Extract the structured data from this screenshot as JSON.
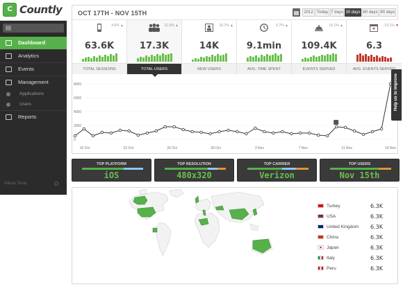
{
  "app": {
    "name": "Countly",
    "logo_mark": "C"
  },
  "sidebar": {
    "items": [
      {
        "label": "Dashboard",
        "icon": "dashboard-icon",
        "active": true
      },
      {
        "label": "Analytics",
        "icon": "analytics-icon"
      },
      {
        "label": "Events",
        "icon": "events-icon"
      },
      {
        "label": "Management",
        "icon": "management-icon"
      }
    ],
    "sub_items": [
      {
        "label": "Applications",
        "icon": "applications-icon"
      },
      {
        "label": "Users",
        "icon": "users-icon"
      }
    ],
    "reports": {
      "label": "Reports",
      "icon": "reports-icon"
    },
    "footer_user": "Nikola Tesla"
  },
  "header": {
    "date_range": "OCT 17TH - NOV 15TH",
    "periods": [
      "2012",
      "Today",
      "7 days",
      "30 days",
      "60 days",
      "90 days"
    ],
    "selected_period": "30 days"
  },
  "metrics": [
    {
      "label": "TOTAL SESSIONS",
      "value": "63.6K",
      "pct": "4.6%",
      "trend": "up",
      "icon": "phone-icon"
    },
    {
      "label": "TOTAL USERS",
      "value": "17.3K",
      "pct": "21.9%",
      "trend": "up",
      "icon": "users-group-icon"
    },
    {
      "label": "NEW USERS",
      "value": "14K",
      "pct": "10.7%",
      "trend": "up",
      "icon": "new-user-icon"
    },
    {
      "label": "AVG. TIME SPENT",
      "value": "9.1min",
      "pct": "5.7%",
      "trend": "up",
      "icon": "clock-icon"
    },
    {
      "label": "EVENTS SERVED",
      "value": "109.4K",
      "pct": "16.1%",
      "trend": "up",
      "icon": "cloche-icon"
    },
    {
      "label": "AVG. EVENTS SERVED",
      "value": "6.3",
      "pct": "-23.1%",
      "trend": "down",
      "icon": "calendar-down-icon"
    }
  ],
  "selected_metric": "TOTAL USERS",
  "chart_data": {
    "type": "line",
    "x_ticks": [
      "16 Oct",
      "22 Oct",
      "26 Oct",
      "30 Oct",
      "3 Nov",
      "7 Nov",
      "11 Nov",
      "14 Nov"
    ],
    "y_ticks": [
      "8000",
      "6000",
      "4000",
      "2000",
      "0"
    ],
    "ylim": [
      0,
      8000
    ],
    "series": [
      {
        "values": [
          500,
          1500,
          500,
          1000,
          900,
          1300,
          1200,
          600,
          900,
          1200,
          1800,
          1800,
          1400,
          1100,
          1000,
          800,
          1100,
          1300,
          1100,
          800,
          1600,
          1100,
          900,
          1100,
          800,
          900,
          900,
          600,
          500,
          1800,
          1700,
          1200,
          700,
          1100,
          1500,
          9000
        ]
      }
    ],
    "annotation_icon": "note-icon",
    "color": "#333333"
  },
  "dashboard_boxes": [
    {
      "title": "TOP PLATFORM",
      "value": "iOS"
    },
    {
      "title": "TOP RESOLUTION",
      "value": "480x320"
    },
    {
      "title": "TOP CARRIER",
      "value": "Verizon"
    },
    {
      "title": "TOP USERS",
      "value": "Nov 15th"
    }
  ],
  "countries": [
    {
      "name": "Turkey",
      "value": "6.3K",
      "flag_color": "#e30a17"
    },
    {
      "name": "USA",
      "value": "6.3K",
      "flag_color": "#3c3b6e"
    },
    {
      "name": "United Kingdom",
      "value": "6.3K",
      "flag_color": "#012169"
    },
    {
      "name": "China",
      "value": "6.3K",
      "flag_color": "#de2910"
    },
    {
      "name": "Japan",
      "value": "6.3K",
      "flag_color": "#ffffff"
    },
    {
      "name": "Italy",
      "value": "6.3K",
      "flag_color": "#009246"
    },
    {
      "name": "Peru",
      "value": "6.3K",
      "flag_color": "#d91023"
    }
  ],
  "feedback": {
    "label": "Help us to improve"
  },
  "colors": {
    "accent": "#56b14b",
    "dark": "#2b2b2b",
    "down": "#c0392b"
  }
}
